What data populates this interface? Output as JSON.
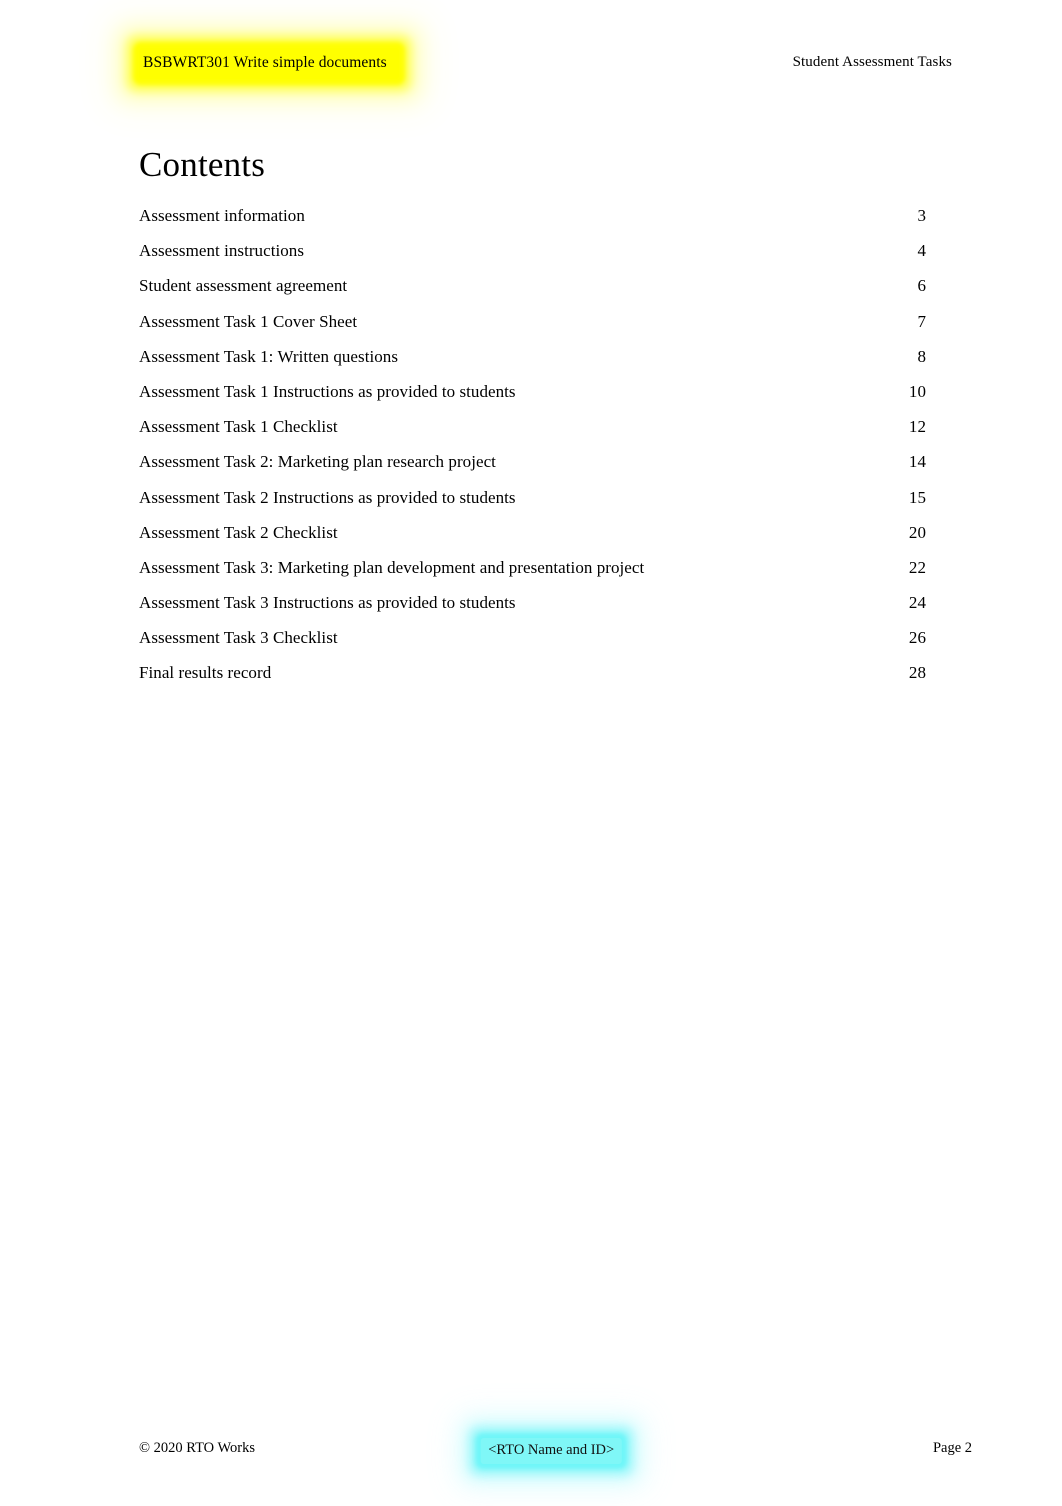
{
  "header": {
    "course_code_title": "BSBWRT301 Write simple documents",
    "document_type": "Student Assessment Tasks",
    "highlight_color": "#ffff00"
  },
  "main": {
    "heading": "Contents",
    "toc": [
      {
        "title": "Assessment information",
        "page": "3"
      },
      {
        "title": "Assessment instructions",
        "page": "4"
      },
      {
        "title": "Student assessment agreement",
        "page": "6"
      },
      {
        "title": "Assessment Task 1 Cover Sheet",
        "page": "7"
      },
      {
        "title": "Assessment Task 1: Written questions",
        "page": "8"
      },
      {
        "title": "Assessment Task 1 Instructions as provided to students",
        "page": "10"
      },
      {
        "title": "Assessment Task 1 Checklist",
        "page": "12"
      },
      {
        "title": "Assessment Task 2: Marketing plan research project",
        "page": "14"
      },
      {
        "title": "Assessment Task 2 Instructions as provided to students",
        "page": "15"
      },
      {
        "title": "Assessment Task 2 Checklist",
        "page": "20"
      },
      {
        "title": "Assessment Task 3: Marketing plan development and presentation project",
        "page": "22"
      },
      {
        "title": "Assessment Task 3 Instructions as provided to students",
        "page": "24"
      },
      {
        "title": "Assessment Task 3 Checklist",
        "page": "26"
      },
      {
        "title": "Final results record",
        "page": "28"
      }
    ]
  },
  "footer": {
    "copyright": "© 2020 RTO Works",
    "rto_placeholder": "<RTO Name and ID>",
    "page_label": "Page 2",
    "highlight_color": "#7ff7f7"
  }
}
